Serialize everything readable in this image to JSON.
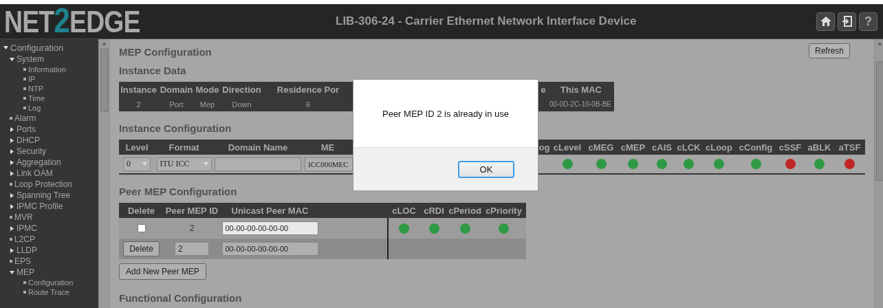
{
  "header": {
    "logo": {
      "before": "NET",
      "accent": "2",
      "after": "EDGE"
    },
    "title": "LIB-306-24 - Carrier Ethernet Network Interface Device",
    "help_button": "?"
  },
  "sidebar": {
    "items": [
      {
        "label": "Configuration",
        "kind": "folder",
        "expanded": true,
        "children": [
          {
            "label": "System",
            "kind": "folder",
            "expanded": true,
            "children": [
              {
                "label": "Information",
                "kind": "page"
              },
              {
                "label": "IP",
                "kind": "page"
              },
              {
                "label": "NTP",
                "kind": "page"
              },
              {
                "label": "Time",
                "kind": "page"
              },
              {
                "label": "Log",
                "kind": "page"
              }
            ]
          },
          {
            "label": "Alarm",
            "kind": "page"
          },
          {
            "label": "Ports",
            "kind": "folder",
            "expanded": false
          },
          {
            "label": "DHCP",
            "kind": "folder",
            "expanded": false
          },
          {
            "label": "Security",
            "kind": "folder",
            "expanded": false
          },
          {
            "label": "Aggregation",
            "kind": "folder",
            "expanded": false
          },
          {
            "label": "Link OAM",
            "kind": "folder",
            "expanded": false
          },
          {
            "label": "Loop Protection",
            "kind": "page"
          },
          {
            "label": "Spanning Tree",
            "kind": "folder",
            "expanded": false
          },
          {
            "label": "IPMC Profile",
            "kind": "folder",
            "expanded": false
          },
          {
            "label": "MVR",
            "kind": "page"
          },
          {
            "label": "IPMC",
            "kind": "folder",
            "expanded": false
          },
          {
            "label": "L2CP",
            "kind": "page"
          },
          {
            "label": "LLDP",
            "kind": "folder",
            "expanded": false
          },
          {
            "label": "EPS",
            "kind": "page"
          },
          {
            "label": "MEP",
            "kind": "folder",
            "expanded": true,
            "children": [
              {
                "label": "Configuration",
                "kind": "page"
              },
              {
                "label": "Route Trace",
                "kind": "page"
              }
            ]
          }
        ]
      }
    ]
  },
  "page": {
    "title": "MEP Configuration",
    "refresh_button": "Refresh",
    "instance_data": {
      "title": "Instance Data",
      "columns": [
        "Instance",
        "Domain",
        "Mode",
        "Direction",
        "Residence Por",
        "e",
        "This MAC"
      ],
      "row": [
        "2",
        "Port",
        "Mep",
        "Down",
        "6",
        "00-0D-2C-10-0B-BE"
      ]
    },
    "instance_configuration": {
      "title": "Instance Configuration",
      "columns": [
        "Level",
        "Format",
        "Domain Name",
        "ME",
        "og",
        "cLevel",
        "cMEG",
        "cMEP",
        "cAIS",
        "cLCK",
        "cLoop",
        "cConfig",
        "cSSF",
        "aBLK",
        "aTSF"
      ],
      "row": {
        "level": "0",
        "format": "ITU ICC",
        "meg_id": "ICC000MEC",
        "indicators": [
          {
            "color": "#2e9a44"
          },
          {
            "color": "#2e9a44"
          },
          {
            "color": "#2e9a44"
          },
          {
            "color": "#2e9a44"
          },
          {
            "color": "#2e9a44"
          },
          {
            "color": "#2e9a44"
          },
          {
            "color": "#2e9a44"
          },
          {
            "color": "#c02626"
          },
          {
            "color": "#2e9a44"
          },
          {
            "color": "#c02626"
          }
        ]
      }
    },
    "peer_mep_configuration": {
      "title": "Peer MEP Configuration",
      "columns": [
        "Delete",
        "Peer MEP ID",
        "Unicast Peer MAC",
        "cLOC",
        "cRDI",
        "cPeriod",
        "cPriority"
      ],
      "rows": [
        {
          "kind": "existing",
          "checked": false,
          "peer_mep_id": "2",
          "mac": "00-00-00-00-00-00",
          "indicators": [
            {
              "color": "#2e9a44"
            },
            {
              "color": "#2e9a44"
            },
            {
              "color": "#2e9a44"
            },
            {
              "color": "#2e9a44"
            }
          ]
        },
        {
          "kind": "new",
          "delete_button": "Delete",
          "peer_mep_id": "2",
          "mac": "00-00-00-00-00-00"
        }
      ]
    },
    "add_button": "Add New Peer MEP",
    "functional_configuration": {
      "title": "Functional Configuration"
    }
  },
  "dialog": {
    "message": "Peer MEP ID 2 is already in use",
    "ok_button": "OK"
  }
}
